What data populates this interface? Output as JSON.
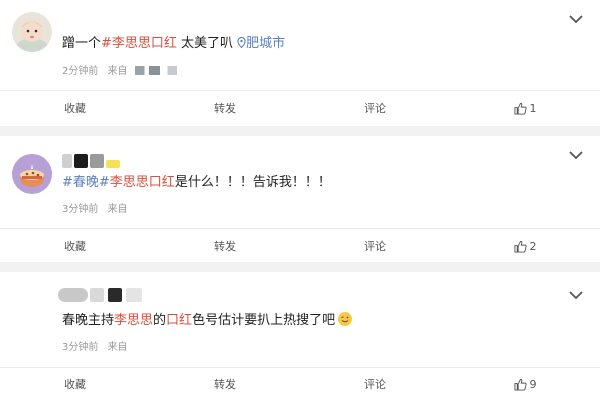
{
  "posts": [
    {
      "content_prefix": "蹭一个",
      "hashtag": "#李思思口红",
      "content_suffix": " 太美了叭",
      "location": "肥城市",
      "time": "2分钟前",
      "source": "来自",
      "actions": {
        "favorite": "收藏",
        "repost": "转发",
        "comment": "评论",
        "likes": "1"
      }
    },
    {
      "hashtag1": "#春晚#",
      "hashtag2": "李思思口红",
      "content_suffix": "是什么！！！告诉我！！！",
      "time": "3分钟前",
      "source": "来自",
      "actions": {
        "favorite": "收藏",
        "repost": "转发",
        "comment": "评论",
        "likes": "2"
      }
    },
    {
      "content_a": "春晚主持",
      "name": "李思思",
      "content_b": "的",
      "lipstick": "口红",
      "content_c": "色号估计要扒上热搜了吧",
      "time": "3分钟前",
      "source": "来自",
      "actions": {
        "favorite": "收藏",
        "repost": "转发",
        "comment": "评论",
        "likes": "9"
      }
    }
  ],
  "colors": {
    "hashtag_red": "#d6513e",
    "hashtag_blue": "#5b7fb8",
    "meta_gray": "#9a9a9a"
  },
  "icons": [
    "avatar-baby",
    "avatar-cake",
    "chevron-down-icon",
    "location-icon",
    "thumbs-up-icon",
    "wink-emoji-icon"
  ]
}
